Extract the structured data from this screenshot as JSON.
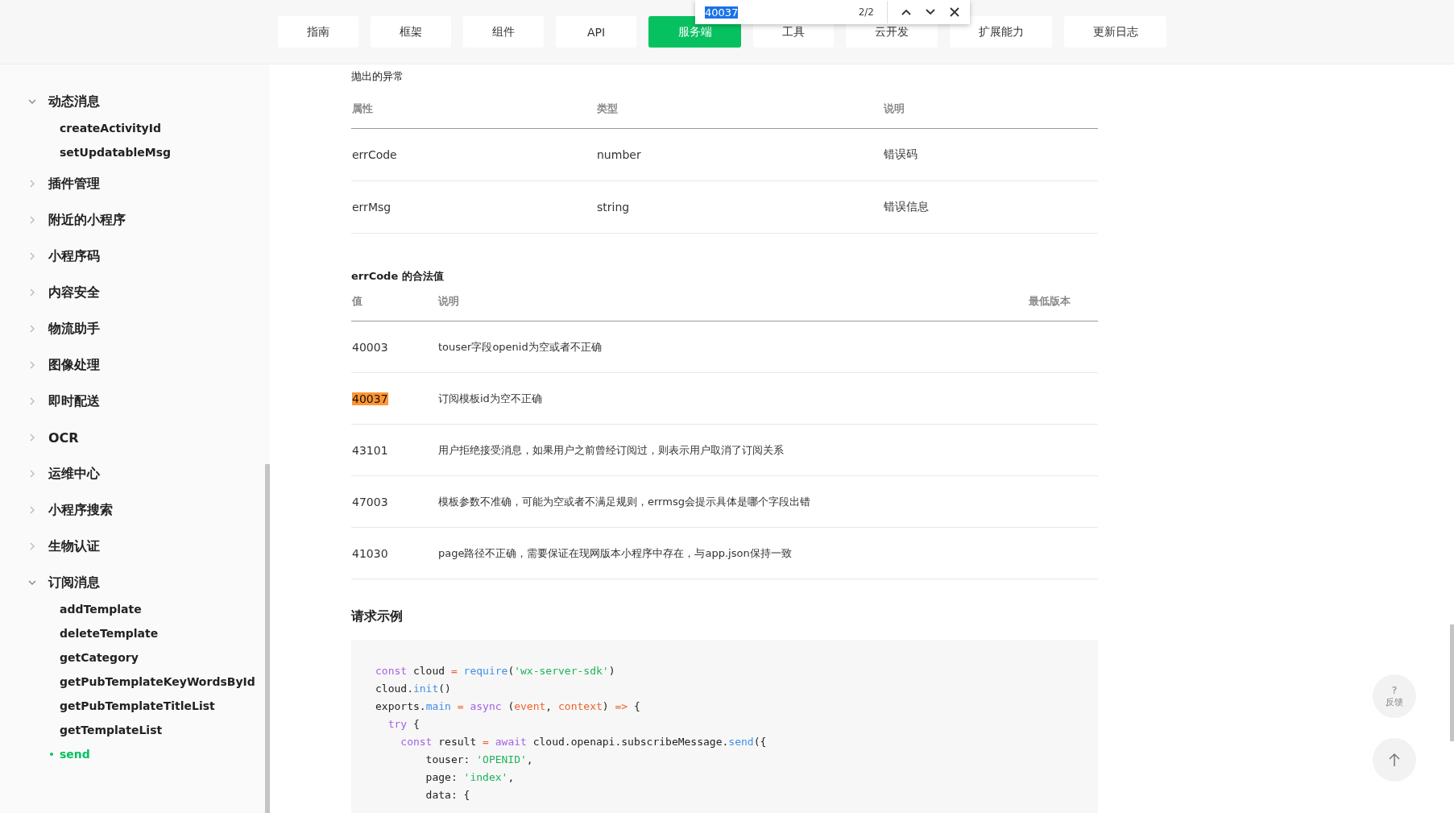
{
  "nav_tabs": [
    {
      "label": "指南",
      "selected": false
    },
    {
      "label": "框架",
      "selected": false
    },
    {
      "label": "组件",
      "selected": false
    },
    {
      "label": "API",
      "selected": false
    },
    {
      "label": "服务端",
      "selected": true
    },
    {
      "label": "工具",
      "selected": false
    },
    {
      "label": "云开发",
      "selected": false
    },
    {
      "label": "扩展能力",
      "selected": false
    },
    {
      "label": "更新日志",
      "selected": false
    }
  ],
  "find_bar": {
    "value": "40037",
    "count": "2/2"
  },
  "sidebar": {
    "items": [
      {
        "label": "动态消息",
        "expanded": true,
        "children": [
          {
            "label": "createActivityId",
            "selected": false
          },
          {
            "label": "setUpdatableMsg",
            "selected": false
          }
        ]
      },
      {
        "label": "插件管理",
        "expanded": false
      },
      {
        "label": "附近的小程序",
        "expanded": false
      },
      {
        "label": "小程序码",
        "expanded": false
      },
      {
        "label": "内容安全",
        "expanded": false
      },
      {
        "label": "物流助手",
        "expanded": false
      },
      {
        "label": "图像处理",
        "expanded": false
      },
      {
        "label": "即时配送",
        "expanded": false
      },
      {
        "label": "OCR",
        "expanded": false
      },
      {
        "label": "运维中心",
        "expanded": false
      },
      {
        "label": "小程序搜索",
        "expanded": false
      },
      {
        "label": "生物认证",
        "expanded": false
      },
      {
        "label": "订阅消息",
        "expanded": true,
        "children": [
          {
            "label": "addTemplate",
            "selected": false
          },
          {
            "label": "deleteTemplate",
            "selected": false
          },
          {
            "label": "getCategory",
            "selected": false
          },
          {
            "label": "getPubTemplateKeyWordsById",
            "selected": false
          },
          {
            "label": "getPubTemplateTitleList",
            "selected": false
          },
          {
            "label": "getTemplateList",
            "selected": false
          },
          {
            "label": "send",
            "selected": true
          }
        ]
      }
    ]
  },
  "exceptions": {
    "caption": "抛出的异常",
    "columns": [
      "属性",
      "类型",
      "说明"
    ],
    "rows": [
      [
        "errCode",
        "number",
        "错误码"
      ],
      [
        "errMsg",
        "string",
        "错误信息"
      ]
    ]
  },
  "errcode_values": {
    "title": "errCode 的合法值",
    "columns": [
      "值",
      "说明",
      "最低版本"
    ],
    "rows": [
      {
        "value": "40003",
        "description": "touser字段openid为空或者不正确",
        "highlighted": false
      },
      {
        "value": "40037",
        "description": "订阅模板id为空不正确",
        "highlighted": true
      },
      {
        "value": "43101",
        "description": "用户拒绝接受消息，如果用户之前曾经订阅过，则表示用户取消了订阅关系",
        "highlighted": false
      },
      {
        "value": "47003",
        "description": "模板参数不准确，可能为空或者不满足规则，errmsg会提示具体是哪个字段出错",
        "highlighted": false
      },
      {
        "value": "41030",
        "description": "page路径不正确，需要保证在现网版本小程序中存在，与app.json保持一致",
        "highlighted": false
      }
    ]
  },
  "request_example": {
    "title": "请求示例",
    "code_lines": [
      [
        {
          "text": "const",
          "kind": "keyword"
        },
        {
          "text": " cloud ",
          "kind": "plain"
        },
        {
          "text": "=",
          "kind": "operator"
        },
        {
          "text": " require",
          "kind": "function"
        },
        {
          "text": "(",
          "kind": "plain"
        },
        {
          "text": "'wx-server-sdk'",
          "kind": "string"
        },
        {
          "text": ")",
          "kind": "plain"
        }
      ],
      [
        {
          "text": "cloud.",
          "kind": "plain"
        },
        {
          "text": "init",
          "kind": "function"
        },
        {
          "text": "()",
          "kind": "plain"
        }
      ],
      [
        {
          "text": "exports.",
          "kind": "plain"
        },
        {
          "text": "main",
          "kind": "function"
        },
        {
          "text": " =",
          "kind": "operator"
        },
        {
          "text": " async",
          "kind": "keyword"
        },
        {
          "text": " (",
          "kind": "plain"
        },
        {
          "text": "event",
          "kind": "param"
        },
        {
          "text": ", ",
          "kind": "plain"
        },
        {
          "text": "context",
          "kind": "param"
        },
        {
          "text": ") ",
          "kind": "plain"
        },
        {
          "text": "=>",
          "kind": "operator"
        },
        {
          "text": " {",
          "kind": "plain"
        }
      ],
      [
        {
          "text": "  try",
          "kind": "keyword"
        },
        {
          "text": " {",
          "kind": "plain"
        }
      ],
      [
        {
          "text": "    const",
          "kind": "keyword"
        },
        {
          "text": " result ",
          "kind": "plain"
        },
        {
          "text": "=",
          "kind": "operator"
        },
        {
          "text": " await",
          "kind": "keyword"
        },
        {
          "text": " cloud.openapi.subscribeMessage.",
          "kind": "plain"
        },
        {
          "text": "send",
          "kind": "function"
        },
        {
          "text": "({",
          "kind": "plain"
        }
      ],
      [
        {
          "text": "        touser: ",
          "kind": "plain"
        },
        {
          "text": "'OPENID'",
          "kind": "string"
        },
        {
          "text": ",",
          "kind": "plain"
        }
      ],
      [
        {
          "text": "        page: ",
          "kind": "plain"
        },
        {
          "text": "'index'",
          "kind": "string"
        },
        {
          "text": ",",
          "kind": "plain"
        }
      ],
      [
        {
          "text": "        data: {",
          "kind": "plain"
        }
      ]
    ]
  },
  "feedback_button": {
    "label": "反馈",
    "glyph": "?"
  }
}
